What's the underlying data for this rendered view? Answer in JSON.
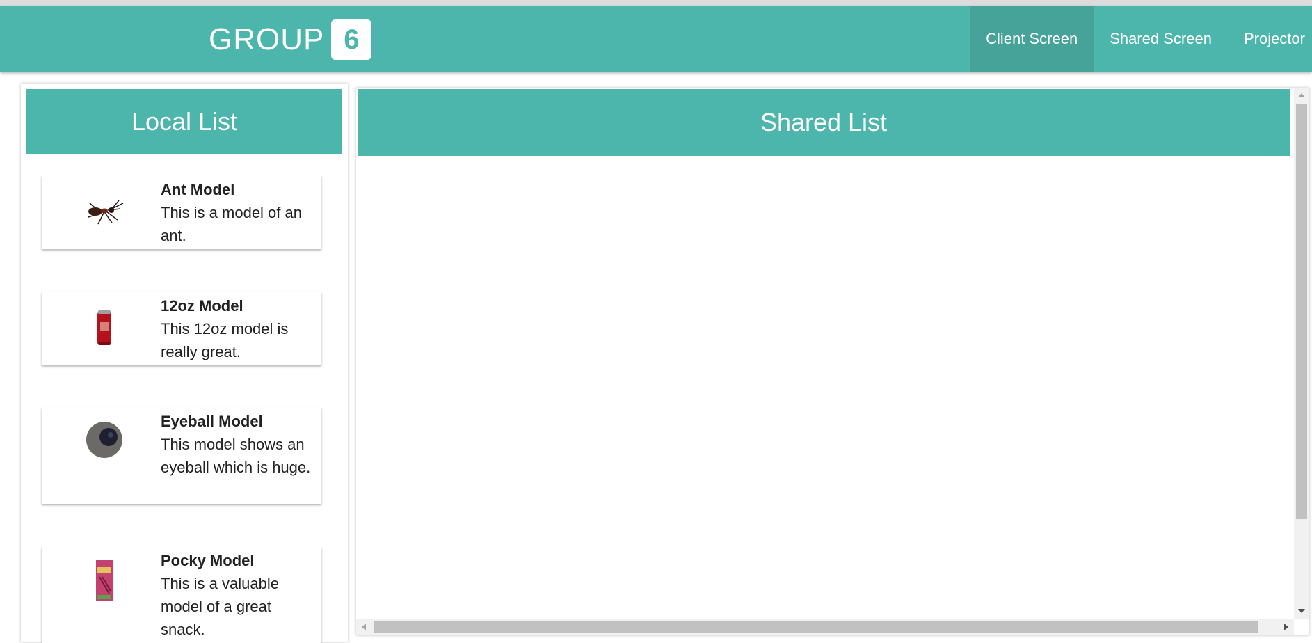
{
  "navbar": {
    "brand_text": "GROUP",
    "brand_badge": "6",
    "links": [
      {
        "label": "Client Screen",
        "active": true
      },
      {
        "label": "Shared Screen",
        "active": false
      },
      {
        "label": "Projector",
        "active": false
      }
    ]
  },
  "local_list": {
    "title": "Local List",
    "items": [
      {
        "title": "Ant Model",
        "description": "This is a model of an ant.",
        "icon": "ant-icon"
      },
      {
        "title": "12oz Model",
        "description": "This 12oz model is really great.",
        "icon": "soda-can-icon"
      },
      {
        "title": "Eyeball Model",
        "description": "This model shows an eyeball which is huge.",
        "icon": "eyeball-icon"
      },
      {
        "title": "Pocky Model",
        "description": "This is a valuable model of a great snack.",
        "icon": "pocky-box-icon"
      }
    ]
  },
  "shared_list": {
    "title": "Shared List"
  },
  "colors": {
    "primary": "#4db6ac",
    "primary_active": "#46a399"
  }
}
